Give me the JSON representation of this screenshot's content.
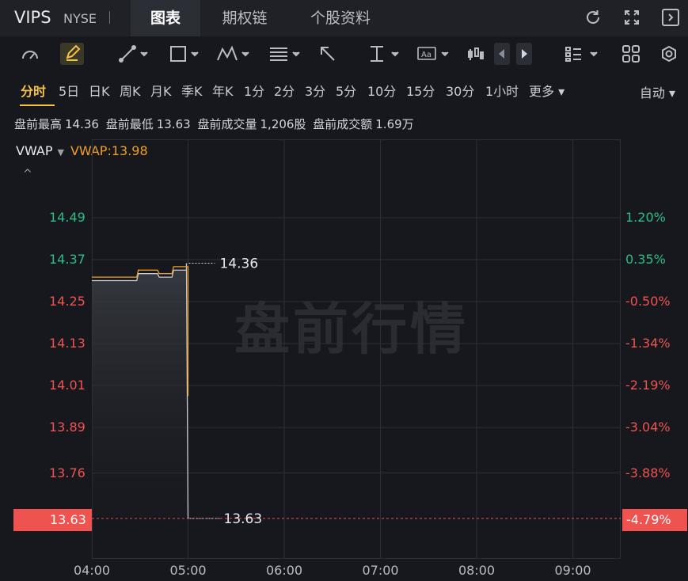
{
  "header": {
    "ticker": "VIPS",
    "exchange": "NYSE",
    "tabs": [
      {
        "label": "图表",
        "active": true
      },
      {
        "label": "期权链",
        "active": false
      },
      {
        "label": "个股资料",
        "active": false
      }
    ],
    "icons": [
      "refresh-icon",
      "fullscreen-icon",
      "collapse-panel-icon"
    ]
  },
  "toolbar": {
    "tools": [
      "gauge-icon",
      "pen-icon",
      "line-tool-icon",
      "rectangle-tool-icon",
      "pattern-tool-icon",
      "fib-tool-icon",
      "arrow-tool-icon",
      "measure-tool-icon",
      "text-tool-icon",
      "candles-icon",
      "prev-icon",
      "next-icon",
      "list-icon",
      "grid-icon",
      "settings-icon"
    ]
  },
  "periods": {
    "items": [
      "分时",
      "5日",
      "日K",
      "周K",
      "月K",
      "季K",
      "年K",
      "1分",
      "2分",
      "3分",
      "5分",
      "10分",
      "15分",
      "30分",
      "1小时",
      "更多"
    ],
    "active": "分时",
    "more_caret": "▾",
    "auto": "自动 ▾"
  },
  "stats": {
    "high_label": "盘前最高",
    "high": "14.36",
    "low_label": "盘前最低",
    "low": "13.63",
    "vol_label": "盘前成交量",
    "vol": "1,206股",
    "amt_label": "盘前成交额",
    "amt": "1.69万"
  },
  "indicator": {
    "name": "VWAP",
    "caret": "▼",
    "value_text": "VWAP:13.98",
    "collapse": "^"
  },
  "watermark": "盘前行情",
  "colors": {
    "up": "#2ebd85",
    "down": "#ef5350",
    "vwap": "#f0a020",
    "price_line": "#c8ccd4",
    "accent": "#f5c242"
  },
  "chart_data": {
    "type": "line",
    "x_ticks": [
      "04:00",
      "05:00",
      "06:00",
      "07:00",
      "08:00",
      "09:00"
    ],
    "y_ticks_left": [
      "14.49",
      "14.37",
      "14.25",
      "14.13",
      "14.01",
      "13.89",
      "13.76",
      "13.63"
    ],
    "y_ticks_right": [
      "1.20%",
      "0.35%",
      "-0.50%",
      "-1.34%",
      "-2.19%",
      "-3.04%",
      "-3.88%",
      "-4.79%"
    ],
    "y_tick_values": [
      14.49,
      14.37,
      14.25,
      14.13,
      14.01,
      13.89,
      13.76,
      13.63
    ],
    "x_range": [
      "04:00",
      "09:30"
    ],
    "ylim": [
      13.63,
      14.49
    ],
    "series": [
      {
        "name": "price",
        "x": [
          "04:00",
          "04:28",
          "04:29",
          "04:41",
          "04:42",
          "04:50",
          "04:51",
          "04:59",
          "04:59",
          "05:00"
        ],
        "values": [
          14.31,
          14.31,
          14.33,
          14.33,
          14.32,
          14.32,
          14.34,
          14.34,
          14.36,
          13.63
        ]
      },
      {
        "name": "VWAP",
        "x": [
          "04:00",
          "04:28",
          "04:29",
          "04:41",
          "04:42",
          "04:50",
          "04:51",
          "04:59",
          "05:00",
          "05:00"
        ],
        "values": [
          14.32,
          14.32,
          14.34,
          14.34,
          14.33,
          14.33,
          14.35,
          14.35,
          14.35,
          13.98
        ]
      }
    ],
    "annotations": {
      "high_label": "14.36",
      "low_label": "13.63",
      "current_price": "13.63",
      "current_pct": "-4.79%"
    },
    "grid": true
  }
}
